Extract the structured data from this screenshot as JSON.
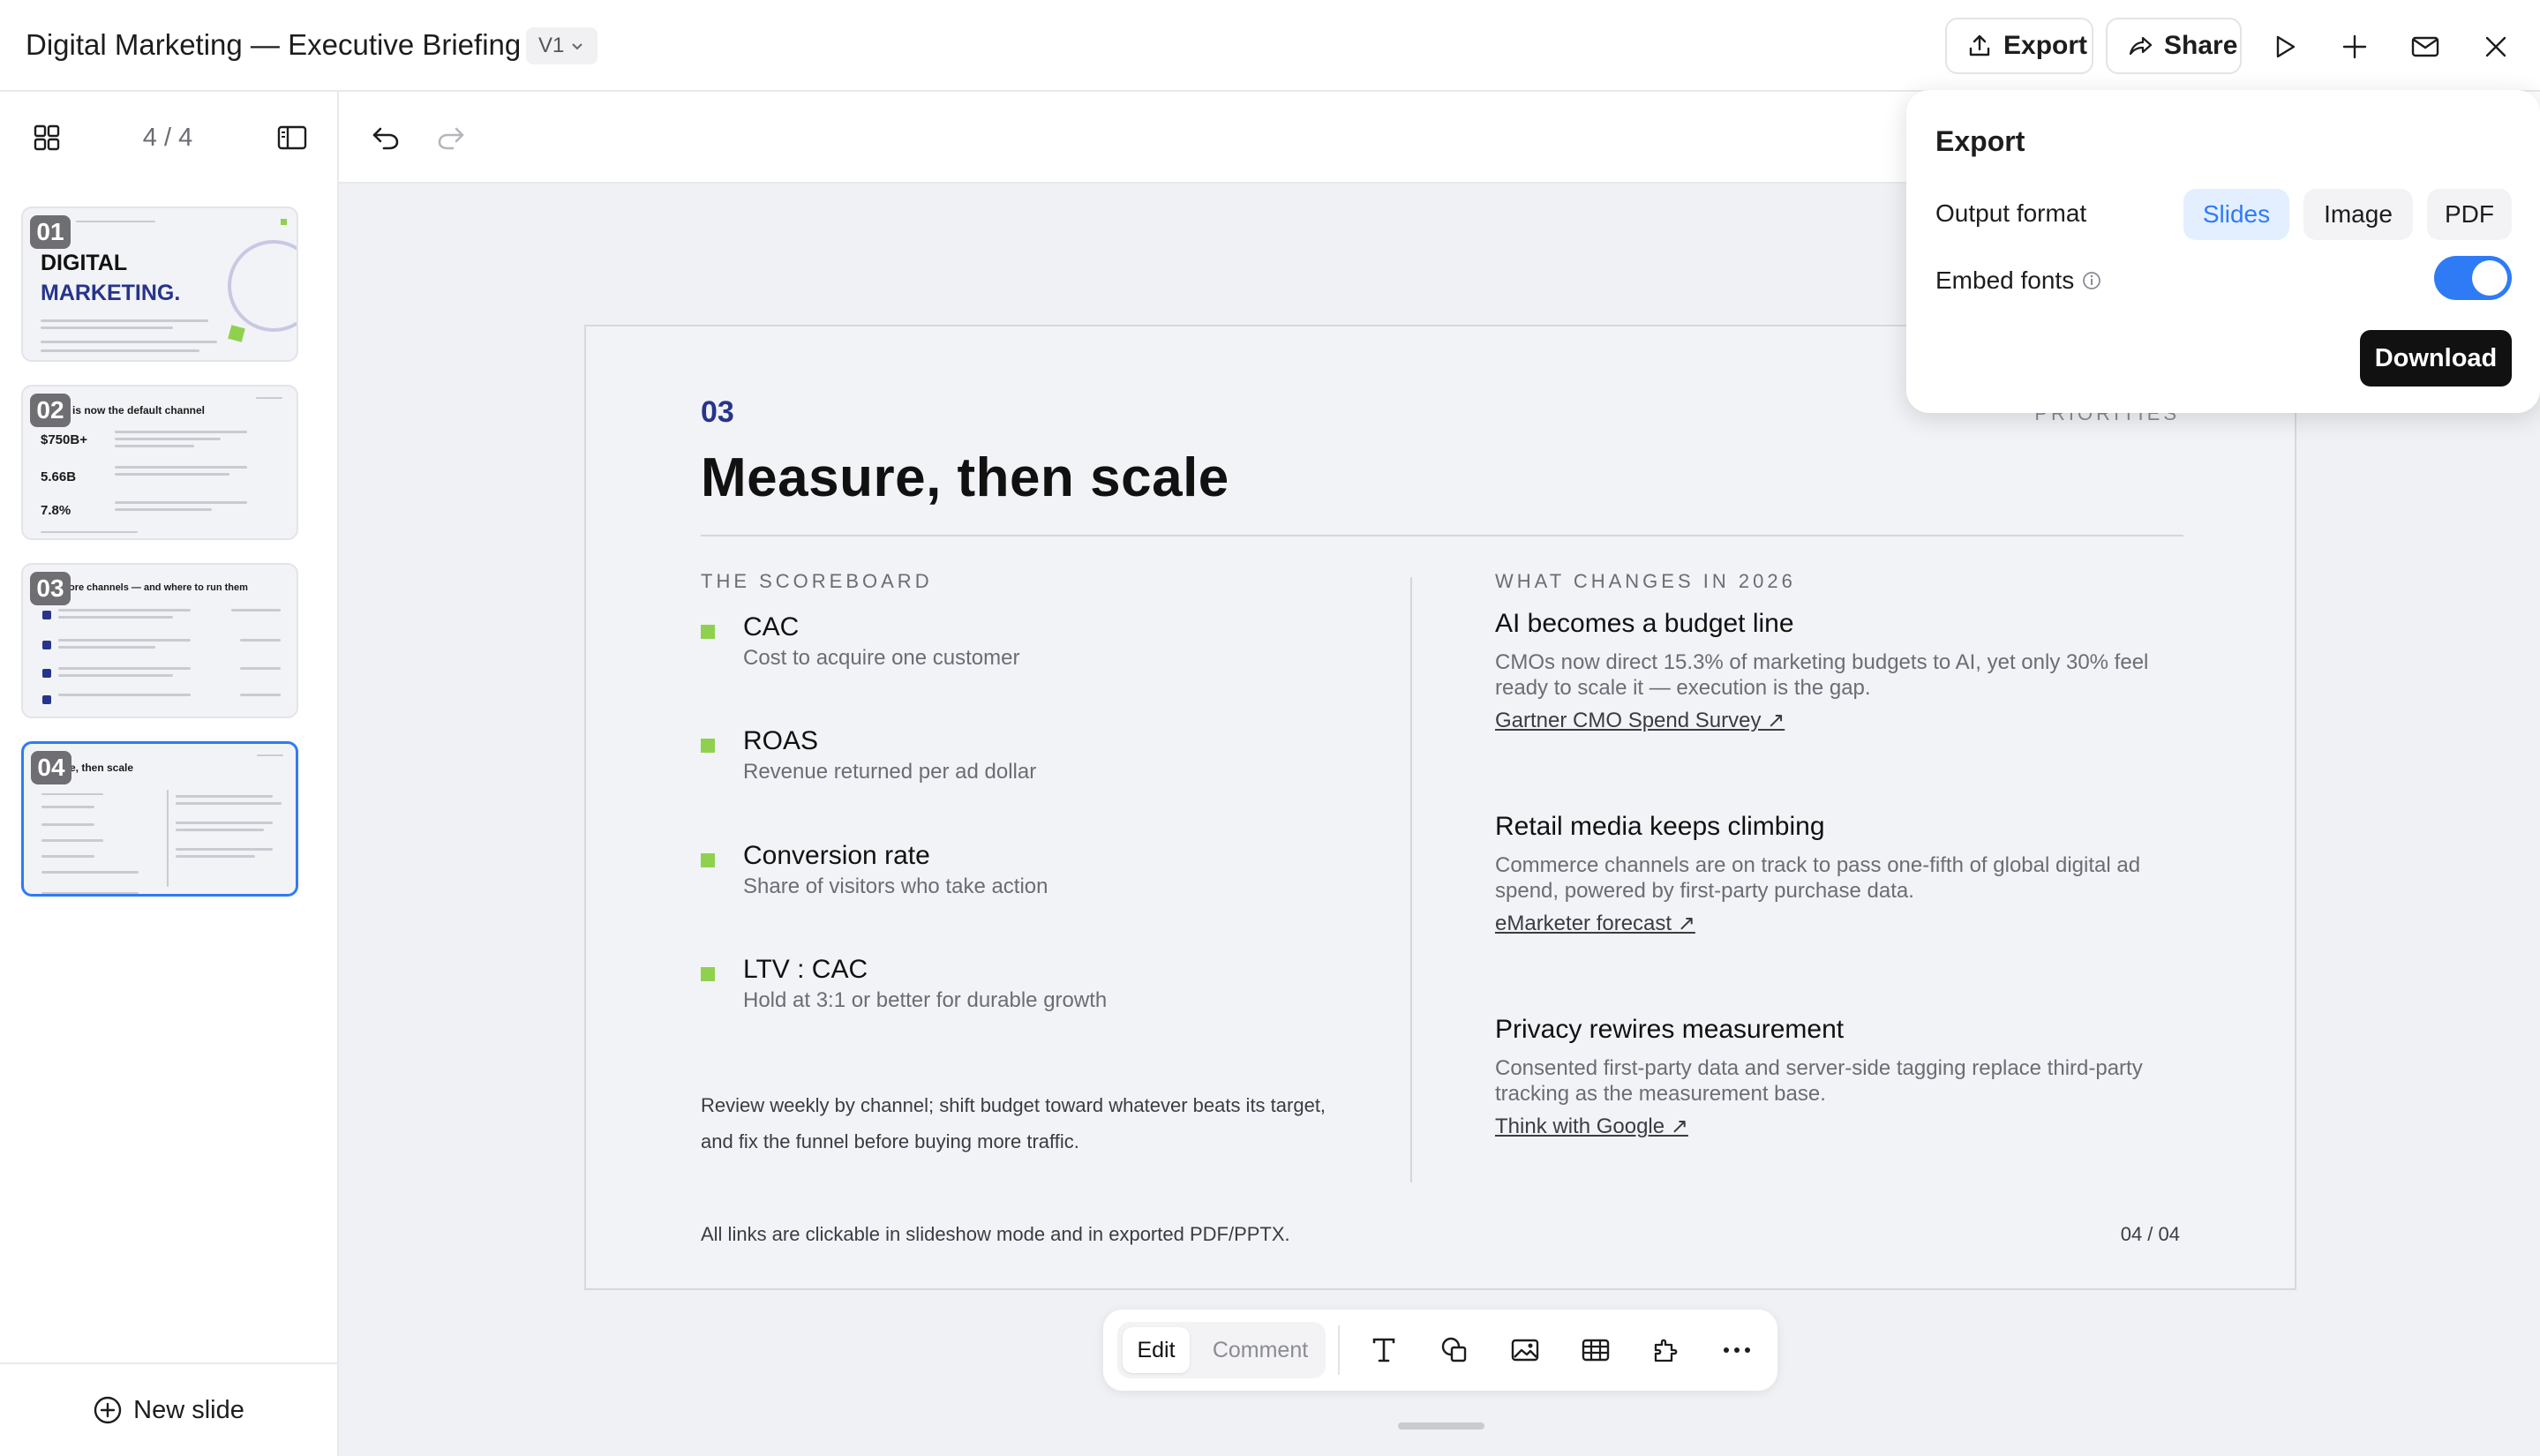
{
  "header": {
    "title": "Digital Marketing — Executive Briefing",
    "version": "V1",
    "export_label": "Export",
    "share_label": "Share",
    "icons": [
      "play-icon",
      "plus-icon",
      "mail-icon",
      "close-icon"
    ]
  },
  "sidebar": {
    "page_count": "4 / 4",
    "new_slide_label": "New slide",
    "thumbnails": [
      {
        "number": "01",
        "title_line1": "DIGITAL",
        "title_line2": "MARKETING."
      },
      {
        "number": "02",
        "heading": "is now the default channel",
        "stats": [
          "$750B+",
          "5.66B",
          "7.8%"
        ]
      },
      {
        "number": "03",
        "heading": "ore channels — and where to run them"
      },
      {
        "number": "04",
        "heading": "e, then scale"
      }
    ]
  },
  "slide": {
    "number": "03",
    "kicker": "PRIORITIES",
    "title": "Measure, then scale",
    "left_heading": "THE SCOREBOARD",
    "right_heading": "WHAT CHANGES IN 2026",
    "metrics": [
      {
        "name": "CAC",
        "desc": "Cost to acquire one customer"
      },
      {
        "name": "ROAS",
        "desc": "Revenue returned per ad dollar"
      },
      {
        "name": "Conversion rate",
        "desc": "Share of visitors who take action"
      },
      {
        "name": "LTV : CAC",
        "desc": "Hold at 3:1 or better for durable growth"
      }
    ],
    "note": "Review weekly by channel; shift budget toward whatever beats its target, and fix the funnel before buying more traffic.",
    "changes": [
      {
        "title": "AI becomes a budget line",
        "body": "CMOs now direct 15.3% of marketing budgets to AI, yet only 30% feel ready to scale it — execution is the gap.",
        "link": "Gartner CMO Spend Survey ↗"
      },
      {
        "title": "Retail media keeps climbing",
        "body": "Commerce channels are on track to pass one-fifth of global digital ad spend, powered by first-party purchase data.",
        "link": "eMarketer forecast ↗"
      },
      {
        "title": "Privacy rewires measurement",
        "body": "Consented first-party data and server-side tagging replace third-party tracking as the measurement base.",
        "link": "Think with Google ↗"
      }
    ],
    "footer": "All links are clickable in slideshow mode and in exported PDF/PPTX.",
    "page": "04 / 04"
  },
  "bottom_toolbar": {
    "edit_label": "Edit",
    "comment_label": "Comment",
    "icons": [
      "text-icon",
      "shapes-icon",
      "image-icon",
      "table-icon",
      "plugin-icon",
      "more-icon"
    ]
  },
  "export_panel": {
    "title": "Export",
    "output_format_label": "Output format",
    "formats": [
      "Slides",
      "Image",
      "PDF"
    ],
    "selected_format": "Slides",
    "embed_fonts_label": "Embed fonts",
    "embed_fonts_enabled": true,
    "download_label": "Download"
  },
  "colors": {
    "accent": "#2f7bf6",
    "slide_number": "#27348b",
    "bullet": "#8fd14f"
  }
}
